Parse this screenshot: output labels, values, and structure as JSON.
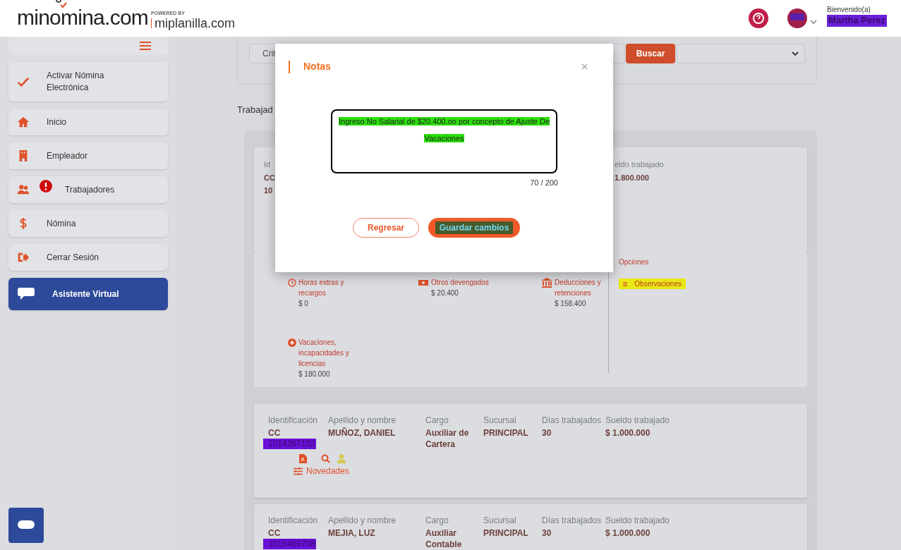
{
  "header": {
    "logo": "minomina.com",
    "powered_by": "POWERED BY",
    "partner": "miplanilla.com",
    "greeting": "Bienvenido(a)",
    "user_name": "Martha Perez"
  },
  "sidebar": {
    "items": [
      {
        "label": "Activar Nómina Electrónica",
        "selected": false,
        "alert": false
      },
      {
        "label": "Inicio",
        "selected": false,
        "alert": false
      },
      {
        "label": "Empleador",
        "selected": false,
        "alert": false
      },
      {
        "label": "Trabajadores",
        "selected": false,
        "alert": true
      },
      {
        "label": "Nómina",
        "selected": false,
        "alert": false
      },
      {
        "label": "Cerrar Sesión",
        "selected": false,
        "alert": false
      },
      {
        "label": "Asistente Virtual",
        "selected": true,
        "alert": false
      }
    ]
  },
  "search": {
    "criterion": "Crit",
    "button": "Buscar"
  },
  "section_title": "Trabajad",
  "first_card": {
    "id_label": "Id",
    "id_type": "CC",
    "id_number": "10",
    "salary_label": "eldo trabajado",
    "salary": "1.800.000",
    "novelties": [
      {
        "label": "Horas extras y recargos",
        "amount": "$ 0"
      },
      {
        "label": "Otros devengados",
        "amount": "$ 20.400"
      },
      {
        "label": "Deducciones y retenciones",
        "amount": "$ 158.400"
      },
      {
        "label": "Vacaciones, incapacidades y licencias",
        "amount": "$ 180.000"
      }
    ],
    "options_title": "Opciones",
    "options": [
      "Observaciones"
    ]
  },
  "workers": [
    {
      "labels": [
        "Identificación",
        "Apellido y nombre",
        "Cargo",
        "Sucursal",
        "Días trabajados",
        "Sueldo trabajado"
      ],
      "id_type": "CC",
      "id_number": "1014267152",
      "name": "MUÑOZ, DANIEL",
      "position": "Auxiliar de Cartera",
      "branch": "PRINCIPAL",
      "days": "30",
      "salary": "$ 1.000.000",
      "novelties_link": "Novedades"
    },
    {
      "labels": [
        "Identificación",
        "Apellido y nombre",
        "Cargo",
        "Sucursal",
        "Días trabajados",
        "Sueldo trabajado"
      ],
      "id_type": "CC",
      "id_number": "1015469708",
      "name": "MEJIA, LUZ",
      "position": "Auxiliar Contable",
      "branch": "PRINCIPAL",
      "days": "30",
      "salary": "$ 1.000.000"
    }
  ],
  "modal": {
    "title": "Notas",
    "text": "Ingreso No Salarial de $20.400.oo por concepto de Ajuste De Vacaciones",
    "counter": "70 / 200",
    "cancel": "Regresar",
    "save": "Guardar cambios"
  }
}
